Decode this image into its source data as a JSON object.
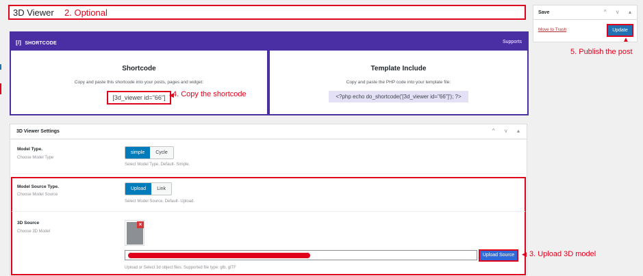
{
  "title": {
    "value": "3D Viewer",
    "annotation": "2. Optional"
  },
  "shortcode_panel": {
    "header_icon": "[/]",
    "header_title": "SHORTCODE",
    "supports": "Supports",
    "shortcode_card": {
      "heading": "Shortcode",
      "description": "Copy and paste this shortcode into your posts, pages and widget:",
      "code": "[3d_viewer id=\"66\"]",
      "annotation": "4. Copy the shortcode"
    },
    "template_card": {
      "heading": "Template Include",
      "description": "Copy and paste the PHP code into your template file:",
      "code": "<?php echo do_shortcode('[3d_viewer id=\"66\"]'); ?>"
    }
  },
  "settings": {
    "title": "3D Viewer Settings",
    "controls": "^ v ▴",
    "model_type": {
      "label": "Model Type.",
      "sub": "Choose Model Type",
      "options": [
        "simple",
        "Cycle"
      ],
      "selected": "simple",
      "help": "Select Model Type, Default- Simple."
    },
    "model_source_type": {
      "label": "Model Source Type.",
      "sub": "Choose Model Source",
      "options": [
        "Upload",
        "Link"
      ],
      "selected": "Upload",
      "help": "Select Model Source, Default- Upload."
    },
    "source": {
      "label": "3D Source",
      "sub": "Choose 3D Model",
      "upload_button": "Upload Source",
      "help": "Upload or Select 3d object files. Supported file type: glb, glTF",
      "annotation": "3. Upload 3D model"
    }
  },
  "save_box": {
    "title": "Save",
    "controls": "^ v ▴",
    "trash": "Move to Trash",
    "update": "Update",
    "annotation": "5. Publish the post"
  },
  "colors": {
    "accent_purple": "#4a2ea4",
    "annotation_red": "#e0001b",
    "primary_blue": "#2271b1"
  }
}
